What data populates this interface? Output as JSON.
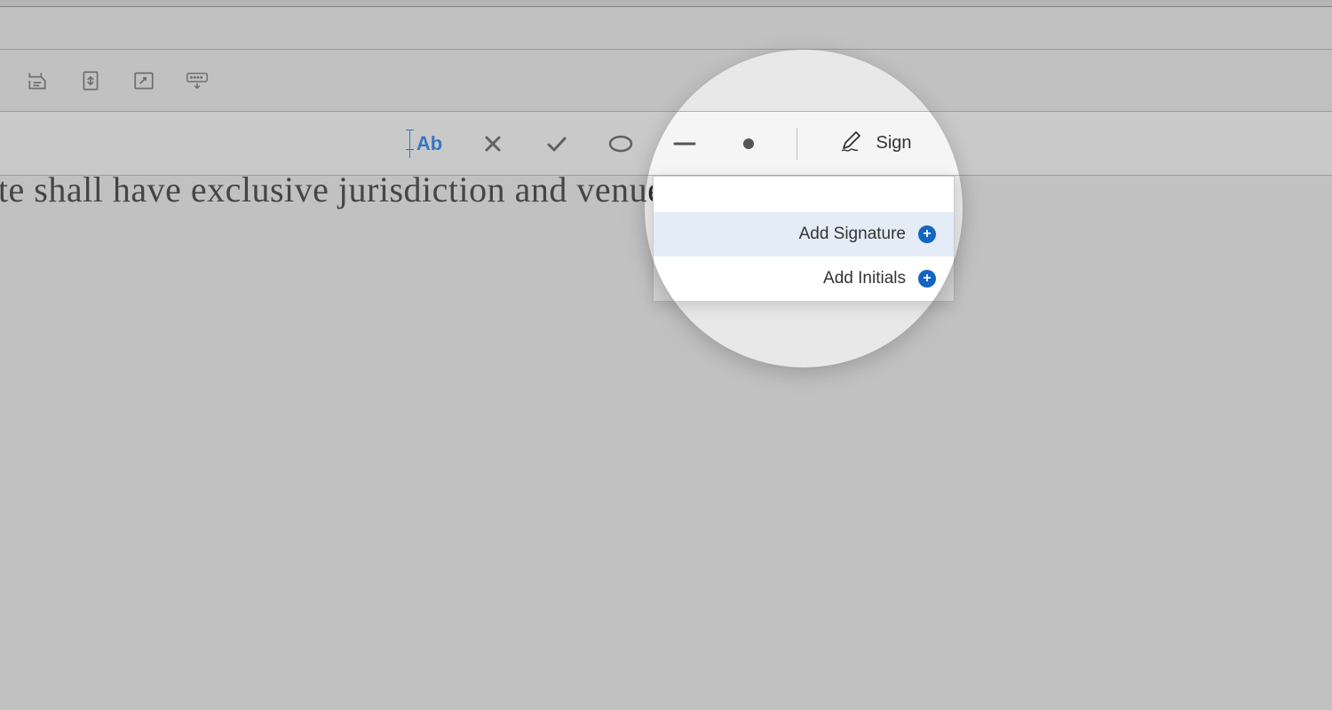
{
  "top_tools": {
    "save": "save-icon",
    "fit_page": "fit-page-icon",
    "fullscreen": "fullscreen-icon",
    "keyboard": "keyboard-icon"
  },
  "fill_sign": {
    "text_tool": "Ab",
    "sign_label": "Sign"
  },
  "document": {
    "visible_text": "state shall have exclusive jurisdiction and venue"
  },
  "sign_menu": {
    "add_signature": "Add Signature",
    "add_initials": "Add Initials"
  }
}
